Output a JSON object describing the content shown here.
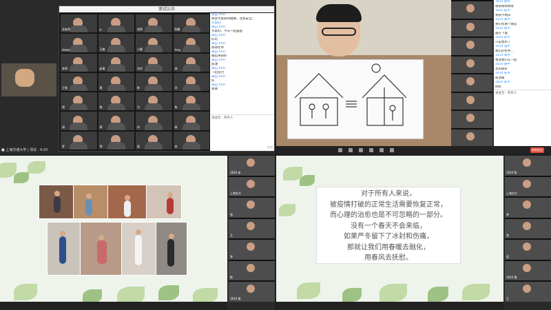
{
  "q1": {
    "window_title": "测试公众",
    "status_text": "■ 上海交通大学 | 测试 · 4:20",
    "gallery_names": [
      "吴老师",
      "lt",
      "张莉",
      "陈静",
      "Helen",
      "王敏",
      "小鹿",
      "Amy",
      "李明",
      "赵倩",
      "刘洋",
      "林",
      "王强",
      "黄",
      "陈",
      "孙",
      "周",
      "杨",
      "马",
      "朱",
      "胡",
      "郭",
      "何",
      "高",
      "罗",
      "郑",
      "梁",
      "宋"
    ],
    "chat_lines": [
      {
        "text": "来自 XXX：",
        "blue": true
      },
      {
        "text": "希望大家保持健康，注意安全。",
        "blue": false
      },
      {
        "text": "大家好",
        "blue": true
      },
      {
        "text": "来自 XXX：",
        "blue": true
      },
      {
        "text": "大家好，今天一起画画",
        "blue": false
      },
      {
        "text": "来自 XXX：",
        "blue": true
      },
      {
        "text": "好的",
        "blue": false
      },
      {
        "text": "来自 XXX：",
        "blue": true
      },
      {
        "text": "谢谢老师",
        "blue": false
      },
      {
        "text": "来自 XXX：",
        "blue": true
      },
      {
        "text": "看起来很好",
        "blue": false
      },
      {
        "text": "来自 XXX：",
        "blue": true
      },
      {
        "text": "加油",
        "blue": false
      },
      {
        "text": "来自 XXX：",
        "blue": true
      },
      {
        "text": "一起努力",
        "blue": false
      },
      {
        "text": "来自 XXX：",
        "blue": true
      },
      {
        "text": "好",
        "blue": false
      },
      {
        "text": "来自 XXX：",
        "blue": true
      },
      {
        "text": "谢谢",
        "blue": false
      }
    ],
    "chat_to": "发送至：所有人",
    "send_label": "发送"
  },
  "q2": {
    "chat_lines": [
      {
        "text": "1810 黄平 ",
        "blue": true
      },
      {
        "text": "嗯嗯嗯嗯嗯嗯",
        "blue": false
      },
      {
        "text": "1810 陈平 ",
        "blue": true
      },
      {
        "text": "我很不明白",
        "blue": false
      },
      {
        "text": "1810 黄平 ",
        "blue": true
      },
      {
        "text": "我们有两个朋友",
        "blue": false
      },
      {
        "text": "1810 陈平 ",
        "blue": true
      },
      {
        "text": "画在下面",
        "blue": false
      },
      {
        "text": "1810 陈平 ",
        "blue": true
      },
      {
        "text": "只是想到了",
        "blue": false
      },
      {
        "text": "1810 张平 ",
        "blue": true
      },
      {
        "text": "我们的世界...",
        "blue": false
      },
      {
        "text": "1810 黄平 ",
        "blue": true
      },
      {
        "text": "希望我们在一起",
        "blue": false
      },
      {
        "text": "1810 黄平 ",
        "blue": true
      },
      {
        "text": "太阳很好",
        "blue": false
      },
      {
        "text": "1810 陈平 ",
        "blue": true
      },
      {
        "text": "很温暖",
        "blue": false
      },
      {
        "text": "1810 陈平 ",
        "blue": true
      },
      {
        "text": "你好",
        "blue": false
      }
    ],
    "chat_to": "发送至：所有人",
    "end_label": "结束会议"
  },
  "q3": {
    "thumb_names": [
      "1810 宋",
      "上海交大",
      "张",
      "王",
      "李",
      "陈",
      "1810 黄"
    ]
  },
  "q4": {
    "poem_lines": [
      "对于所有人来说，",
      "被疫情打破的正常生活需要恢复正常，",
      "而心理的治愈也是不可忽略的一部分。",
      "没有一个春天不会来临，",
      "如果严冬留下了冰封和伤痛，",
      "那就让我们用春暖去融化，",
      "用春风去抚慰。"
    ],
    "thumb_names": [
      "1810 陈",
      "上海交大",
      "李",
      "张",
      "吴",
      "1810 黄",
      "王"
    ]
  },
  "colors": {
    "accent": "#2d8cff",
    "end": "#e74c3c",
    "slide_bg": "#eef4ec"
  }
}
